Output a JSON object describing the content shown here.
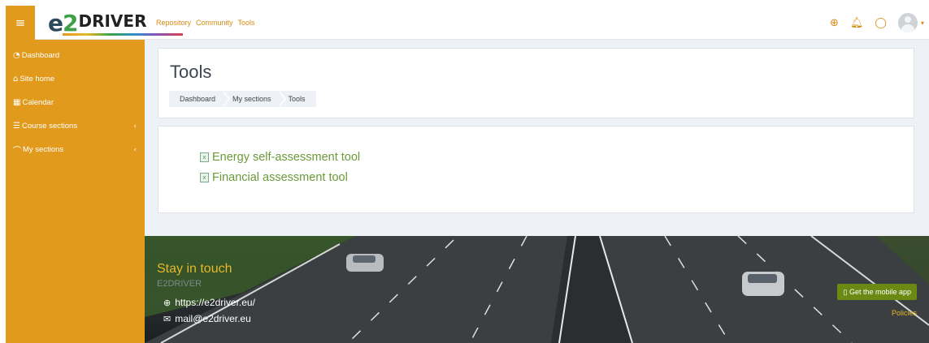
{
  "navbar": {
    "menu_icon": "hamburger-icon",
    "logo": {
      "e": "e",
      "two": "2",
      "driver": "DRIVER"
    },
    "links": [
      "Repository",
      "Community",
      "Tools"
    ],
    "icons": [
      "globe-icon",
      "bell-icon",
      "chat-icon",
      "user-avatar"
    ]
  },
  "sidebar": {
    "items": [
      {
        "label": "Dashboard",
        "icon": "gauge-icon"
      },
      {
        "label": "Site home",
        "icon": "home-icon"
      },
      {
        "label": "Calendar",
        "icon": "calendar-icon"
      },
      {
        "label": "Course sections",
        "icon": "list-icon",
        "expandable": true
      },
      {
        "label": "My sections",
        "icon": "graduation-cap-icon",
        "expandable": true
      }
    ]
  },
  "page": {
    "title": "Tools",
    "breadcrumb": [
      "Dashboard",
      "My sections",
      "Tools"
    ]
  },
  "content": {
    "links": [
      "Energy self-assessment tool",
      "Financial assessment tool"
    ]
  },
  "footer": {
    "heading": "Stay in touch",
    "brand": "E2DRIVER",
    "website": "https://e2driver.eu/",
    "email": "mail@e2driver.eu",
    "mobile_app_button": "Get the mobile app",
    "policies_link": "Policies"
  },
  "colors": {
    "accent": "#e19a1c",
    "link": "#d88a12",
    "green_link": "#6b9a3a",
    "footer_heading": "#e6b82a",
    "app_button": "#6a8a14"
  }
}
